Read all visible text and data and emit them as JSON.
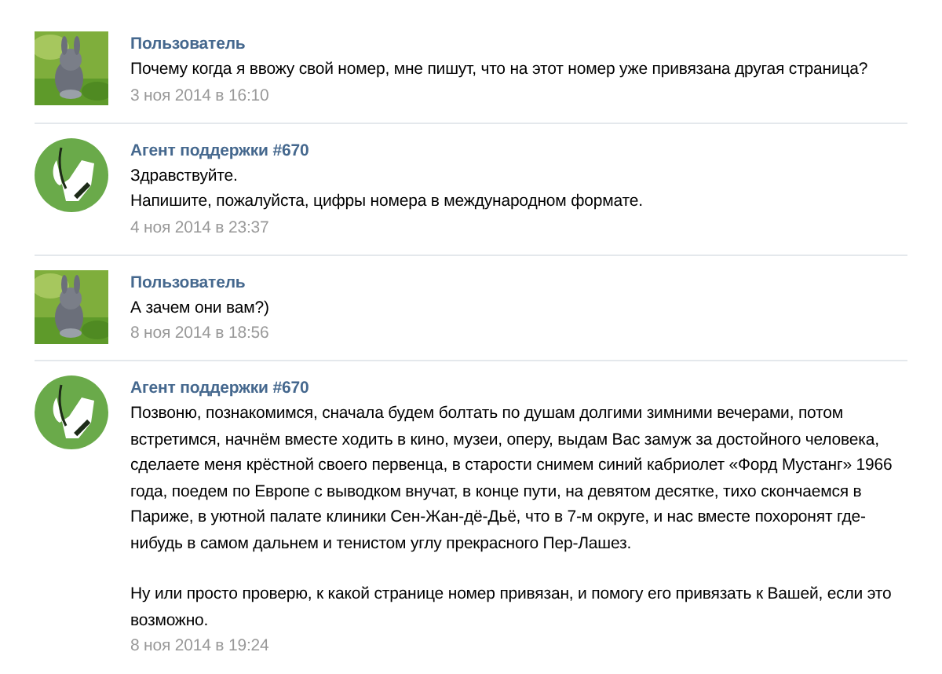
{
  "messages": [
    {
      "kind": "user",
      "author": "Пользователь",
      "paragraphs": [
        "Почему когда я ввожу свой номер, мне пишут, что на этот номер уже привязана другая страница?"
      ],
      "date": "3 ноя 2014 в 16:10"
    },
    {
      "kind": "agent",
      "author": "Агент поддержки #670",
      "paragraphs": [
        "Здравствуйте.\nНапишите, пожалуйста, цифры номера в международном формате."
      ],
      "date": "4 ноя 2014 в 23:37"
    },
    {
      "kind": "user",
      "author": "Пользователь",
      "paragraphs": [
        "А зачем они вам?)"
      ],
      "date": "8 ноя 2014 в 18:56"
    },
    {
      "kind": "agent",
      "author": "Агент поддержки #670",
      "paragraphs": [
        "Позвоню, познакомимся, сначала будем болтать по душам долгими зимними вечерами, потом встретимся, начнём вместе ходить в кино, музеи, оперу, выдам Вас замуж за достойного человека, сделаете меня крёстной своего первенца, в старости снимем синий кабриолет «Форд Мустанг» 1966 года, поедем по Европе с выводком внучат, в конце пути, на девятом десятке, тихо скончаемся в Париже, в уютной палате клиники Сен-Жан-дё-Дьё, что в 7-м округе, и нас вместе похоронят где-нибудь в самом дальнем и тенистом углу прекрасного Пер-Лашез.",
        "Ну или просто проверю, к какой странице номер привязан, и помогу его привязать к Вашей, если это возможно."
      ],
      "date": "8 ноя 2014 в 19:24"
    }
  ]
}
